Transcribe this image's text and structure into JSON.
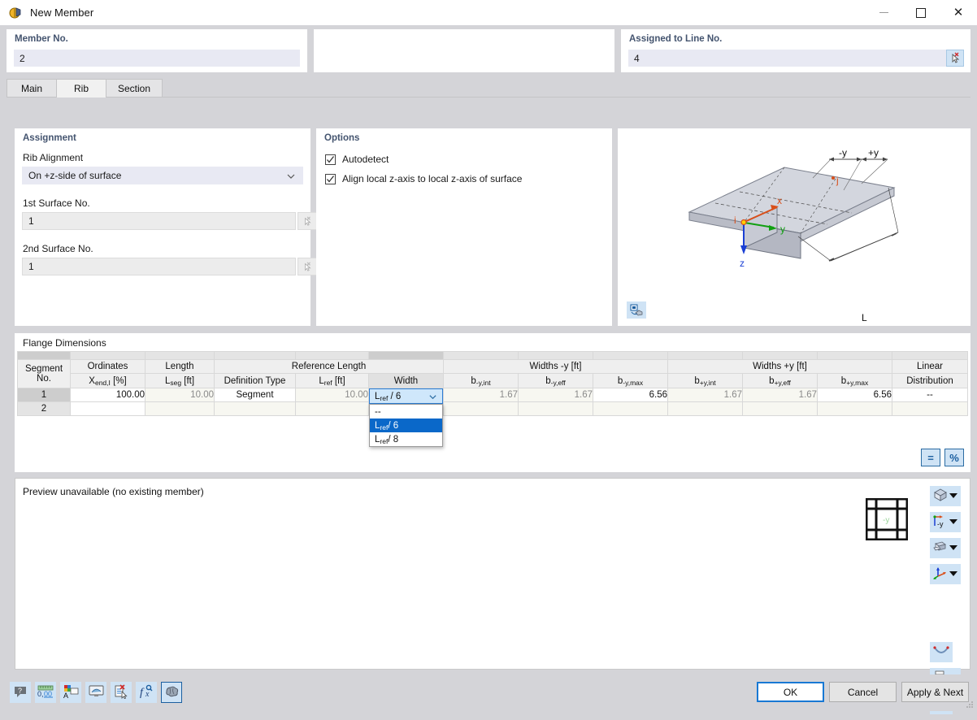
{
  "window": {
    "title": "New Member",
    "icon": "member-icon",
    "minimize": "minimize-icon",
    "maximize": "maximize-icon",
    "close": "close-icon"
  },
  "header": {
    "member_no_label": "Member No.",
    "member_no_value": "2",
    "assigned_line_label": "Assigned to Line No.",
    "assigned_line_value": "4"
  },
  "tabs": [
    {
      "label": "Main",
      "active": false
    },
    {
      "label": "Rib",
      "active": true
    },
    {
      "label": "Section",
      "active": false
    }
  ],
  "assignment": {
    "title": "Assignment",
    "rib_alignment_label": "Rib Alignment",
    "rib_alignment_value": "On +z-side of surface",
    "surface1_label": "1st Surface No.",
    "surface1_value": "1",
    "surface2_label": "2nd Surface No.",
    "surface2_value": "1"
  },
  "options": {
    "title": "Options",
    "items": [
      {
        "label": "Autodetect",
        "checked": true
      },
      {
        "label": "Align local z-axis to local z-axis of surface",
        "checked": true
      }
    ]
  },
  "graphic": {
    "axis_x": "x",
    "axis_y": "y",
    "axis_z": "z",
    "node_i": "i",
    "node_j": "j",
    "dim_minus_y": "-y",
    "dim_plus_y": "+y",
    "dim_length": "L",
    "tool_icon": "render-mode-icon"
  },
  "flange": {
    "title": "Flange Dimensions",
    "group_headers": [
      {
        "label": "",
        "span": 1
      },
      {
        "label": "Ordinates",
        "span": 1
      },
      {
        "label": "Length",
        "span": 1
      },
      {
        "label": "Reference Length",
        "span": 3
      },
      {
        "label": "Widths -y [ft]",
        "span": 3
      },
      {
        "label": "Widths +y [ft]",
        "span": 3
      },
      {
        "label": "Linear",
        "span": 1
      }
    ],
    "columns": [
      {
        "top": "Segment",
        "bottom": "No."
      },
      {
        "top": "Ordinates",
        "bottom": "Xend,I [%]"
      },
      {
        "top": "Length",
        "bottom": "Lseg [ft]"
      },
      {
        "top": "",
        "bottom": "Definition Type"
      },
      {
        "top": "",
        "bottom": "Lref [ft]"
      },
      {
        "top": "",
        "bottom": "Width"
      },
      {
        "top": "",
        "bottom": "b-y,int"
      },
      {
        "top": "",
        "bottom": "b-y,eff"
      },
      {
        "top": "",
        "bottom": "b-y,max"
      },
      {
        "top": "",
        "bottom": "b+y,int"
      },
      {
        "top": "",
        "bottom": "b+y,eff"
      },
      {
        "top": "",
        "bottom": "b+y,max"
      },
      {
        "top": "Linear",
        "bottom": "Distribution"
      }
    ],
    "rows": [
      {
        "segment": "1",
        "ordinates": "100.00",
        "length": "10.00",
        "definition_type": "Segment",
        "lref": "10.00",
        "width": "Lref / 6",
        "b_y_int": "1.67",
        "b_y_eff": "1.67",
        "b_y_max": "6.56",
        "bp_y_int": "1.67",
        "bp_y_eff": "1.67",
        "bp_y_max": "6.56",
        "linear_distribution": "--"
      },
      {
        "segment": "2",
        "ordinates": "",
        "length": "",
        "definition_type": "",
        "lref": "",
        "width": "",
        "b_y_int": "",
        "b_y_eff": "",
        "b_y_max": "",
        "bp_y_int": "",
        "bp_y_eff": "",
        "bp_y_max": "",
        "linear_distribution": ""
      }
    ],
    "width_dropdown": {
      "value": "Lref / 6",
      "open": true,
      "options": [
        "--",
        "Lref / 6",
        "Lref / 8"
      ],
      "selected_index": 1
    },
    "table_buttons": [
      {
        "name": "equalize-button",
        "glyph": "="
      },
      {
        "name": "percent-button",
        "glyph": "%"
      }
    ]
  },
  "preview": {
    "message": "Preview unavailable (no existing member)",
    "thumbnail": "grid-thumbnail",
    "thumbnail_axis": "-y",
    "side_buttons": [
      {
        "name": "view-mode-button",
        "icon": "cube-icon",
        "caret": true
      },
      {
        "name": "view-direction-button",
        "icon": "axis-minus-y-icon",
        "caret": true
      },
      {
        "name": "render-style-button",
        "icon": "solid-box-icon",
        "caret": true
      },
      {
        "name": "coordinate-system-button",
        "icon": "axes-icon",
        "caret": true
      },
      {
        "name": "deformation-button",
        "icon": "curve-icon",
        "caret": false
      },
      {
        "name": "print-button",
        "icon": "printer-icon",
        "caret": true
      },
      {
        "name": "clear-selection-button",
        "icon": "magnifier-delete-icon",
        "caret": false
      }
    ]
  },
  "bottom": {
    "tools": [
      {
        "name": "help-button",
        "icon": "question-balloon-icon",
        "active": false
      },
      {
        "name": "units-button",
        "icon": "units-decimal-icon",
        "active": false
      },
      {
        "name": "comment-button",
        "icon": "comment-color-icon",
        "active": false
      },
      {
        "name": "display-button",
        "icon": "monitor-icon",
        "active": false
      },
      {
        "name": "delete-entry-button",
        "icon": "document-delete-icon",
        "active": false
      },
      {
        "name": "formula-button",
        "icon": "function-icon",
        "active": false
      },
      {
        "name": "brain-button",
        "icon": "brain-icon",
        "active": true
      }
    ],
    "buttons": [
      {
        "name": "ok-button",
        "label": "OK",
        "primary": true
      },
      {
        "name": "cancel-button",
        "label": "Cancel",
        "primary": false
      },
      {
        "name": "apply-next-button",
        "label": "Apply & Next",
        "primary": false
      }
    ]
  },
  "colors": {
    "accent": "#1878d4",
    "panel_title": "#44546f",
    "field_bg": "#e8e9f3",
    "dropdown_sel": "#0a68c9",
    "axis_x": "#d94f1a",
    "axis_y": "#11a011",
    "axis_z": "#1a3fd4"
  }
}
